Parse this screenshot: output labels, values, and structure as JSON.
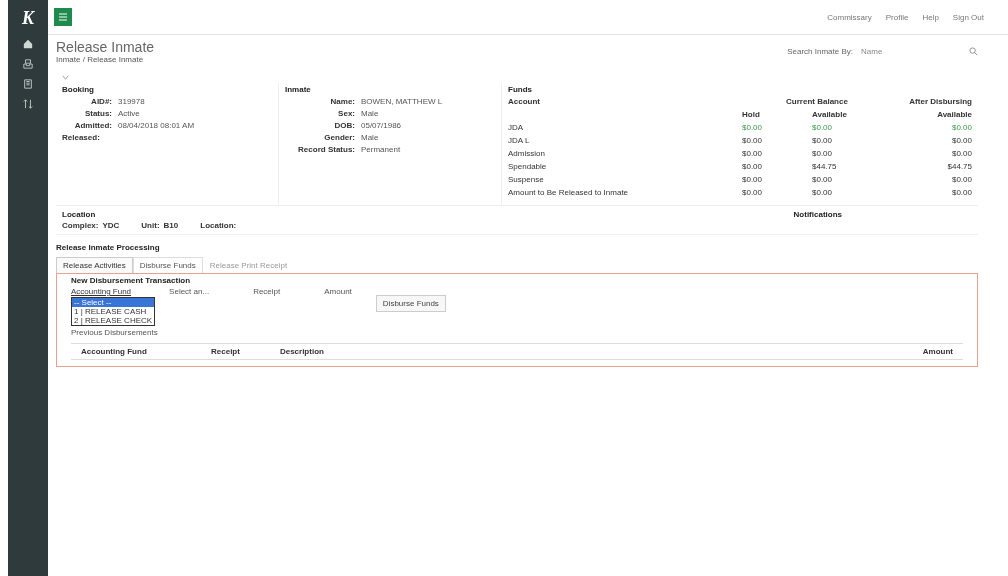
{
  "sidebar": {
    "logo": "K"
  },
  "top_nav": [
    "Commissary",
    "Profile",
    "Help",
    "Sign Out"
  ],
  "page": {
    "title": "Release Inmate",
    "breadcrumb": "Inmate / Release Inmate"
  },
  "search": {
    "label": "Search Inmate By:",
    "placeholder": "Name"
  },
  "booking": {
    "heading": "Booking",
    "fields": [
      {
        "label": "AID#:",
        "value": "319978"
      },
      {
        "label": "Status:",
        "value": "Active"
      },
      {
        "label": "Admitted:",
        "value": "08/04/2018  08:01 AM"
      },
      {
        "label": "Released:"
      }
    ]
  },
  "inmate": {
    "heading": "Inmate",
    "fields": [
      {
        "label": "Name:",
        "value": "BOWEN, MATTHEW L"
      },
      {
        "label": "Sex:",
        "value": "Male"
      },
      {
        "label": "DOB:",
        "value": "05/07/1986"
      },
      {
        "label": "Gender:",
        "value": "Male"
      },
      {
        "label": "Record Status:",
        "value": "Permanent"
      }
    ]
  },
  "funds": {
    "heading": "Funds",
    "columns": [
      "Account",
      "Current Balance",
      "After Disbursing",
      "Hold",
      "Available",
      "Available"
    ],
    "rows": [
      {
        "account": "JDA",
        "hold": "$0.00",
        "available": "$0.00",
        "after": "$0.00",
        "positive": true
      },
      {
        "account": "JDA L",
        "hold": "$0.00",
        "available": "$0.00",
        "after": "$0.00",
        "positive": false
      },
      {
        "account": "Admission",
        "hold": "$0.00",
        "available": "$0.00",
        "after": "$0.00",
        "positive": false
      },
      {
        "account": "Spendable",
        "hold": "$0.00",
        "available": "$44.75",
        "after": "$44.75",
        "positive": false
      },
      {
        "account": "Suspense",
        "hold": "$0.00",
        "available": "$0.00",
        "after": "$0.00",
        "positive": false
      },
      {
        "account": "Amount to Be Released to Inmate",
        "hold": "$0.00",
        "available": "$0.00",
        "after": "$0.00",
        "positive": false
      }
    ]
  },
  "location": {
    "heading": "Location",
    "fields": [
      {
        "label": "Complex:",
        "value": "YDC"
      },
      {
        "label": "Unit:",
        "value": "B10"
      },
      {
        "label": "Location:"
      }
    ]
  },
  "notifications": {
    "heading": "Notifications"
  },
  "processing": {
    "heading": "Release Inmate Processing",
    "tabs": [
      {
        "label": "Release Activities",
        "selected": true,
        "disabled": false
      },
      {
        "label": "Disburse Funds",
        "selected": false,
        "disabled": false
      },
      {
        "label": "Release Print Receipt",
        "selected": false,
        "disabled": true
      }
    ],
    "section": "New Disbursement Transaction",
    "fund_label": "Accounting Fund",
    "fund_value": "Select an...",
    "receipt_label": "Receipt",
    "amount_label": "Amount",
    "button": "Disburse Funds",
    "dropdown": [
      {
        "label": "-- Select --",
        "selected": true
      },
      {
        "label": "1 | RELEASE CASH",
        "selected": false
      },
      {
        "label": "2 | RELEASE CHECK",
        "selected": false
      }
    ],
    "previous": "Previous Disbursements",
    "table_columns": [
      "Accounting Fund",
      "Receipt",
      "Description",
      "Amount"
    ]
  }
}
